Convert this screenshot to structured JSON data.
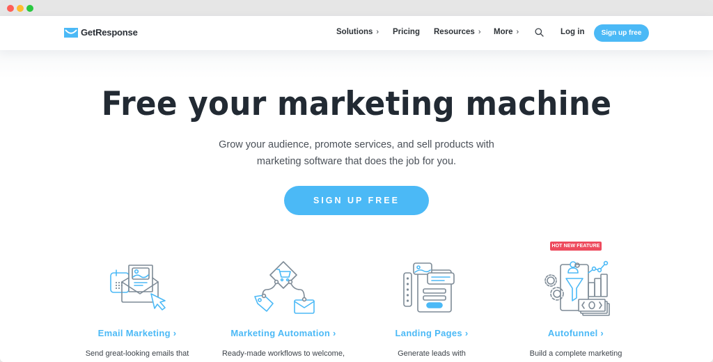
{
  "window": {
    "controls": [
      "close",
      "minimize",
      "maximize"
    ]
  },
  "nav": {
    "logo_text": "GetResponse",
    "items": [
      {
        "label": "Solutions",
        "has_submenu": true,
        "chevron": "›"
      },
      {
        "label": "Pricing",
        "has_submenu": false,
        "chevron": ""
      },
      {
        "label": "Resources",
        "has_submenu": true,
        "chevron": "›"
      },
      {
        "label": "More",
        "has_submenu": true,
        "chevron": "›"
      }
    ],
    "search_icon": "search-icon",
    "login_label": "Log in",
    "signup_label": "Sign up free"
  },
  "hero": {
    "title": "Free your marketing machine",
    "subtitle_line1": "Grow your audience, promote services, and sell products with",
    "subtitle_line2": "marketing software that does the job for you.",
    "cta_label": "SIGN UP FREE"
  },
  "features": [
    {
      "title": "Email Marketing ›",
      "description": "Send great-looking emails that",
      "icon": "email-marketing-icon"
    },
    {
      "title": "Marketing Automation ›",
      "description": "Ready-made workflows to welcome,",
      "icon": "marketing-automation-icon"
    },
    {
      "title": "Landing Pages ›",
      "description": "Generate leads with",
      "icon": "landing-pages-icon"
    },
    {
      "title": "Autofunnel ›",
      "description": "Build a complete marketing",
      "icon": "autofunnel-icon",
      "badge": "HOT NEW FEATURE"
    }
  ],
  "colors": {
    "brand_blue": "#4bb9f6",
    "badge_red": "#ee4a5d",
    "heading_dark": "#222a33",
    "icon_gray": "#7d8a96"
  }
}
